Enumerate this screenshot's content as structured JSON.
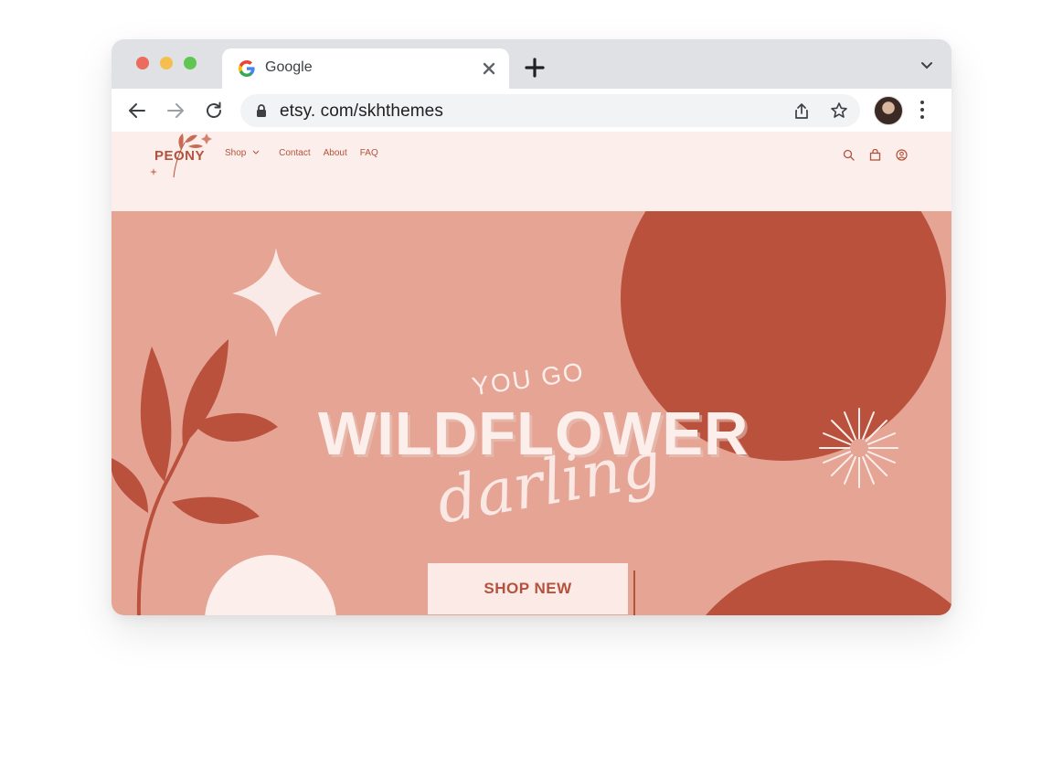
{
  "browser": {
    "tab": {
      "title": "Google",
      "favicon": "google-g-icon"
    },
    "url": "etsy. com/skhthemes",
    "icons": [
      "back-arrow-icon",
      "forward-arrow-icon",
      "reload-icon",
      "lock-icon",
      "share-icon",
      "star-icon",
      "kebab-menu-icon",
      "new-tab-plus-icon",
      "chevron-down-icon",
      "close-icon"
    ]
  },
  "site": {
    "logo": "PEONY",
    "nav": [
      {
        "label": "Shop",
        "has_dropdown": true
      },
      {
        "label": "Contact"
      },
      {
        "label": "About"
      },
      {
        "label": "FAQ"
      }
    ],
    "header_icons": [
      "search-icon",
      "bag-icon",
      "account-icon"
    ],
    "hero": {
      "line1": "YOU GO",
      "line2": "WILDFLOWER",
      "line3": "darling",
      "cta": "SHOP NEW"
    },
    "colors": {
      "header_bg": "#fbeeeb",
      "hero_bg": "#e5a494",
      "accent": "#b5523d",
      "cream": "#fbeeeb"
    }
  }
}
